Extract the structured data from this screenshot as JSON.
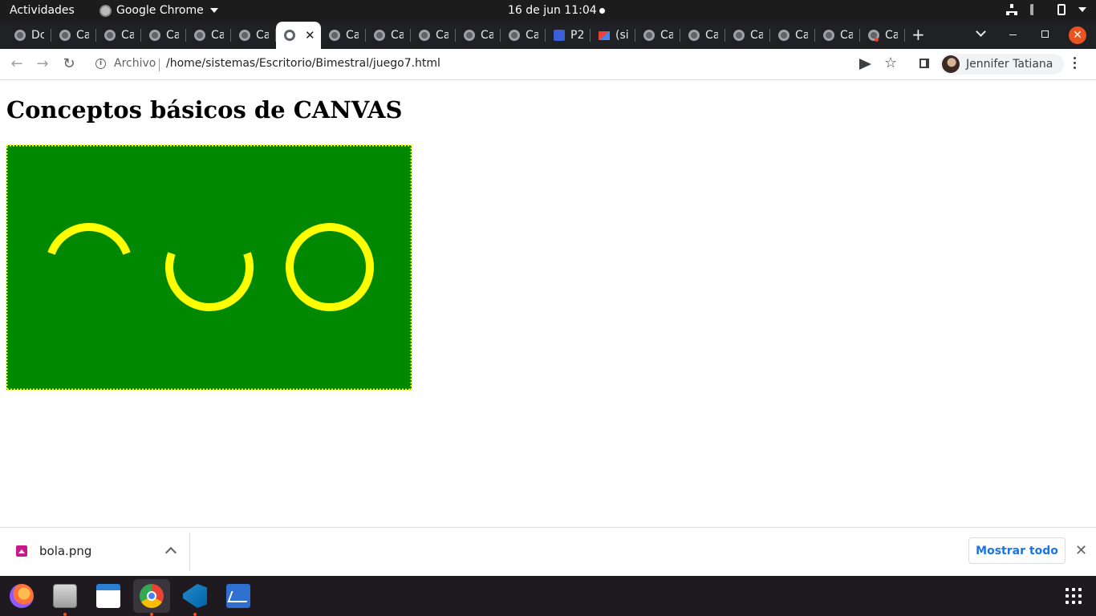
{
  "topbar": {
    "activities": "Actividades",
    "app_name": "Google Chrome",
    "clock": "16 de jun  11:04"
  },
  "tabs": [
    {
      "label": "Dc"
    },
    {
      "label": "Ca"
    },
    {
      "label": "Ca"
    },
    {
      "label": "Ca"
    },
    {
      "label": "Ca"
    },
    {
      "label": "Ca"
    },
    {
      "label": ""
    },
    {
      "label": "Ca"
    },
    {
      "label": "Ca"
    },
    {
      "label": "Ca"
    },
    {
      "label": "Ca"
    },
    {
      "label": "Ca"
    },
    {
      "label": "P2"
    },
    {
      "label": "(si"
    },
    {
      "label": "Ca"
    },
    {
      "label": "Ca"
    },
    {
      "label": "Ca"
    },
    {
      "label": "Ca"
    },
    {
      "label": "Ca"
    },
    {
      "label": "Ca"
    }
  ],
  "active_tab_index": 6,
  "toolbar": {
    "origin_label": "Archivo",
    "url": "/home/sistemas/Escritorio/Bimestral/juego7.html",
    "profile_name": "Jennifer Tatiana"
  },
  "page": {
    "title": "Conceptos básicos de CANVAS",
    "canvas": {
      "background": "#008800",
      "border_color": "#ffff00",
      "stroke_color": "#ffff00",
      "arcs": [
        {
          "shape": "upper-arc"
        },
        {
          "shape": "lower-arc"
        },
        {
          "shape": "full-circle"
        }
      ]
    }
  },
  "downloads": {
    "file_name": "bola.png",
    "show_all_label": "Mostrar todo"
  },
  "dock": {
    "apps": [
      "firefox-icon",
      "files-icon",
      "writer-icon",
      "chrome-icon",
      "vscode-icon",
      "system-monitor-icon"
    ]
  }
}
